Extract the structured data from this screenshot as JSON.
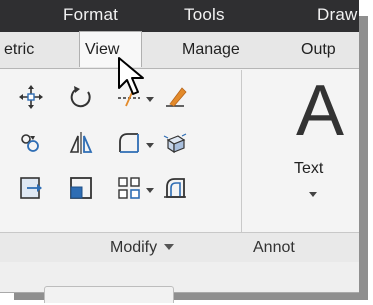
{
  "menubar": {
    "items": [
      "Format",
      "Tools",
      "Draw"
    ]
  },
  "ribbon": {
    "tabs": [
      "etric",
      "View",
      "Manage",
      "Outp"
    ],
    "active_tab_index": 1
  },
  "panels": {
    "modify": {
      "label": "Modify",
      "tools": [
        {
          "icon": "move-icon"
        },
        {
          "icon": "rotate-icon"
        },
        {
          "icon": "trim-icon"
        },
        {
          "icon": "erase-icon"
        },
        {
          "icon": "copy-icon"
        },
        {
          "icon": "mirror-icon"
        },
        {
          "icon": "fillet-icon"
        },
        {
          "icon": "explode-icon"
        },
        {
          "icon": "stretch-icon"
        },
        {
          "icon": "scale-icon"
        },
        {
          "icon": "array-icon"
        },
        {
          "icon": "offset-icon"
        }
      ]
    },
    "annotation": {
      "label": "Annot",
      "big_letter": "A",
      "text_label": "Text"
    }
  },
  "colors": {
    "menubar_bg": "#2f2f31",
    "ribbon_bg": "#f4f4f4",
    "accent_blue": "#2e6db4",
    "accent_orange": "#e38a2a"
  }
}
